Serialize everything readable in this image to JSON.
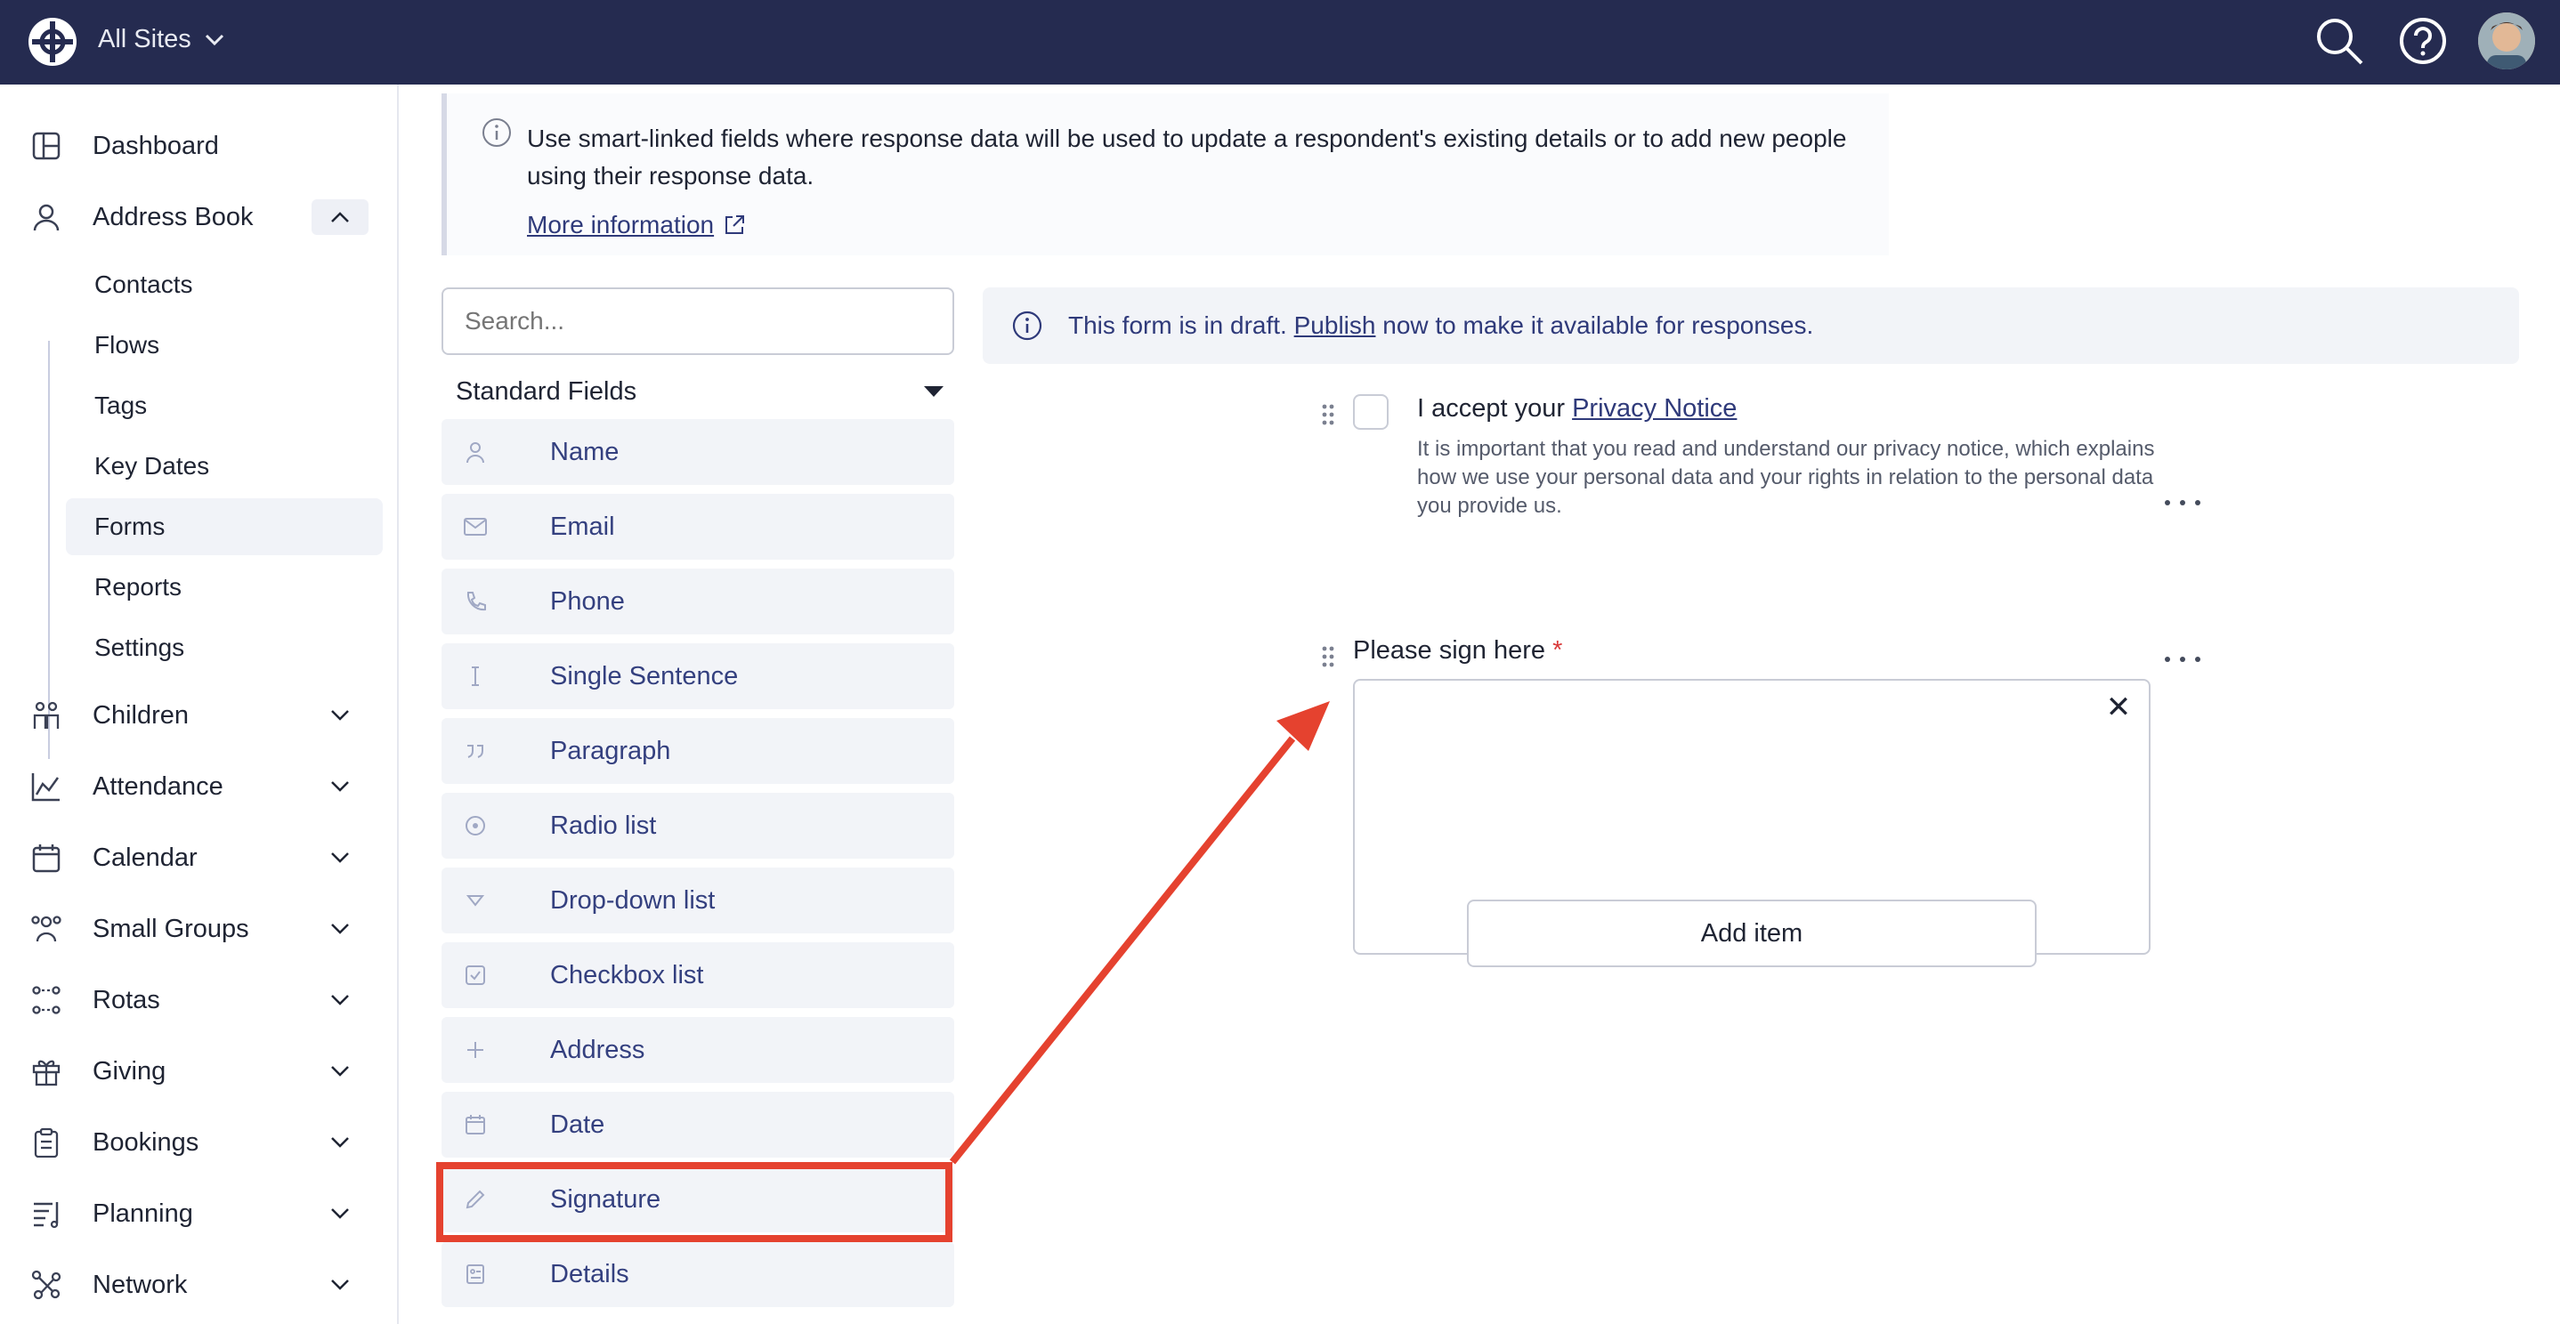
{
  "topbar": {
    "site_selector": "All Sites",
    "icons": [
      "logo-icon",
      "chevron-down-icon",
      "search-icon",
      "help-icon",
      "avatar"
    ]
  },
  "sidebar": {
    "items": [
      {
        "label": "Dashboard",
        "icon": "dashboard-icon"
      },
      {
        "label": "Address Book",
        "icon": "person-icon"
      },
      {
        "label": "Children",
        "icon": "children-icon"
      },
      {
        "label": "Attendance",
        "icon": "chart-icon"
      },
      {
        "label": "Calendar",
        "icon": "calendar-icon"
      },
      {
        "label": "Small Groups",
        "icon": "group-icon"
      },
      {
        "label": "Rotas",
        "icon": "rota-icon"
      },
      {
        "label": "Giving",
        "icon": "gift-icon"
      },
      {
        "label": "Bookings",
        "icon": "clipboard-icon"
      },
      {
        "label": "Planning",
        "icon": "planning-icon"
      },
      {
        "label": "Network",
        "icon": "network-icon"
      }
    ],
    "sub_items": [
      "Contacts",
      "Flows",
      "Tags",
      "Key Dates",
      "Forms",
      "Reports",
      "Settings"
    ],
    "active_sub": "Forms"
  },
  "info": {
    "text": "Use smart-linked fields where response data will be used to update a respondent's existing details or to add new people using their response data.",
    "link": "More information"
  },
  "search": {
    "placeholder": "Search..."
  },
  "fields_header": "Standard Fields",
  "fields": [
    {
      "label": "Name",
      "icon": "person-icon"
    },
    {
      "label": "Email",
      "icon": "envelope-icon"
    },
    {
      "label": "Phone",
      "icon": "phone-icon"
    },
    {
      "label": "Single Sentence",
      "icon": "text-cursor-icon"
    },
    {
      "label": "Paragraph",
      "icon": "quote-icon"
    },
    {
      "label": "Radio list",
      "icon": "radio-icon"
    },
    {
      "label": "Drop-down list",
      "icon": "triangle-down-icon"
    },
    {
      "label": "Checkbox list",
      "icon": "checkbox-icon"
    },
    {
      "label": "Address",
      "icon": "plus-icon"
    },
    {
      "label": "Date",
      "icon": "calendar-icon"
    },
    {
      "label": "Signature",
      "icon": "pencil-icon"
    },
    {
      "label": "Details",
      "icon": "details-icon"
    }
  ],
  "draft": {
    "prefix": "This form is in draft. ",
    "link": "Publish",
    "suffix": " now to make it available for responses."
  },
  "form": {
    "consent_prefix": "I accept your ",
    "consent_link": "Privacy Notice",
    "consent_help": "It is important that you read and understand our privacy notice, which explains how we use your personal data and your rights in relation to the personal data you provide us.",
    "sign_label": "Please sign here",
    "required_mark": "*",
    "clear_symbol": "✕",
    "add_item": "Add item"
  },
  "colors": {
    "topbar": "#252b50",
    "accent_link": "#2f3a7a",
    "highlight": "#e5422f",
    "required": "#d93a3a"
  }
}
